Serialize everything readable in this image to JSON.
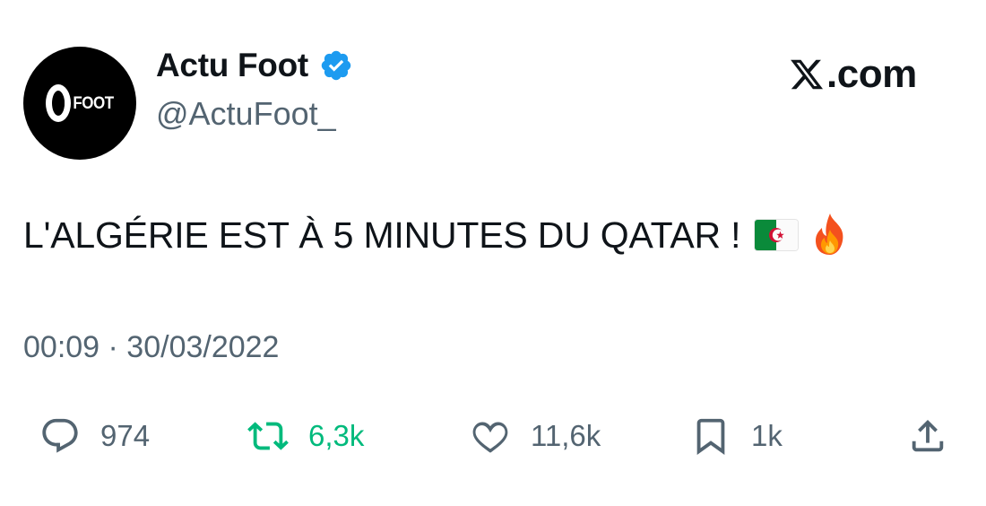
{
  "author": {
    "display_name": "Actu Foot",
    "handle": "@ActuFoot_",
    "avatar_text": "FOOT",
    "verified": true,
    "verified_color": "#1d9bf0"
  },
  "site_logo": ".com",
  "tweet": {
    "text": "L'ALGÉRIE EST À 5 MINUTES DU QATAR !",
    "emojis": [
      "algeria-flag",
      "fire"
    ],
    "timestamp": "00:09 · 30/03/2022"
  },
  "actions": {
    "replies": "974",
    "retweets": "6,3k",
    "likes": "11,6k",
    "bookmarks": "1k",
    "retweet_color": "#00ba7c"
  }
}
